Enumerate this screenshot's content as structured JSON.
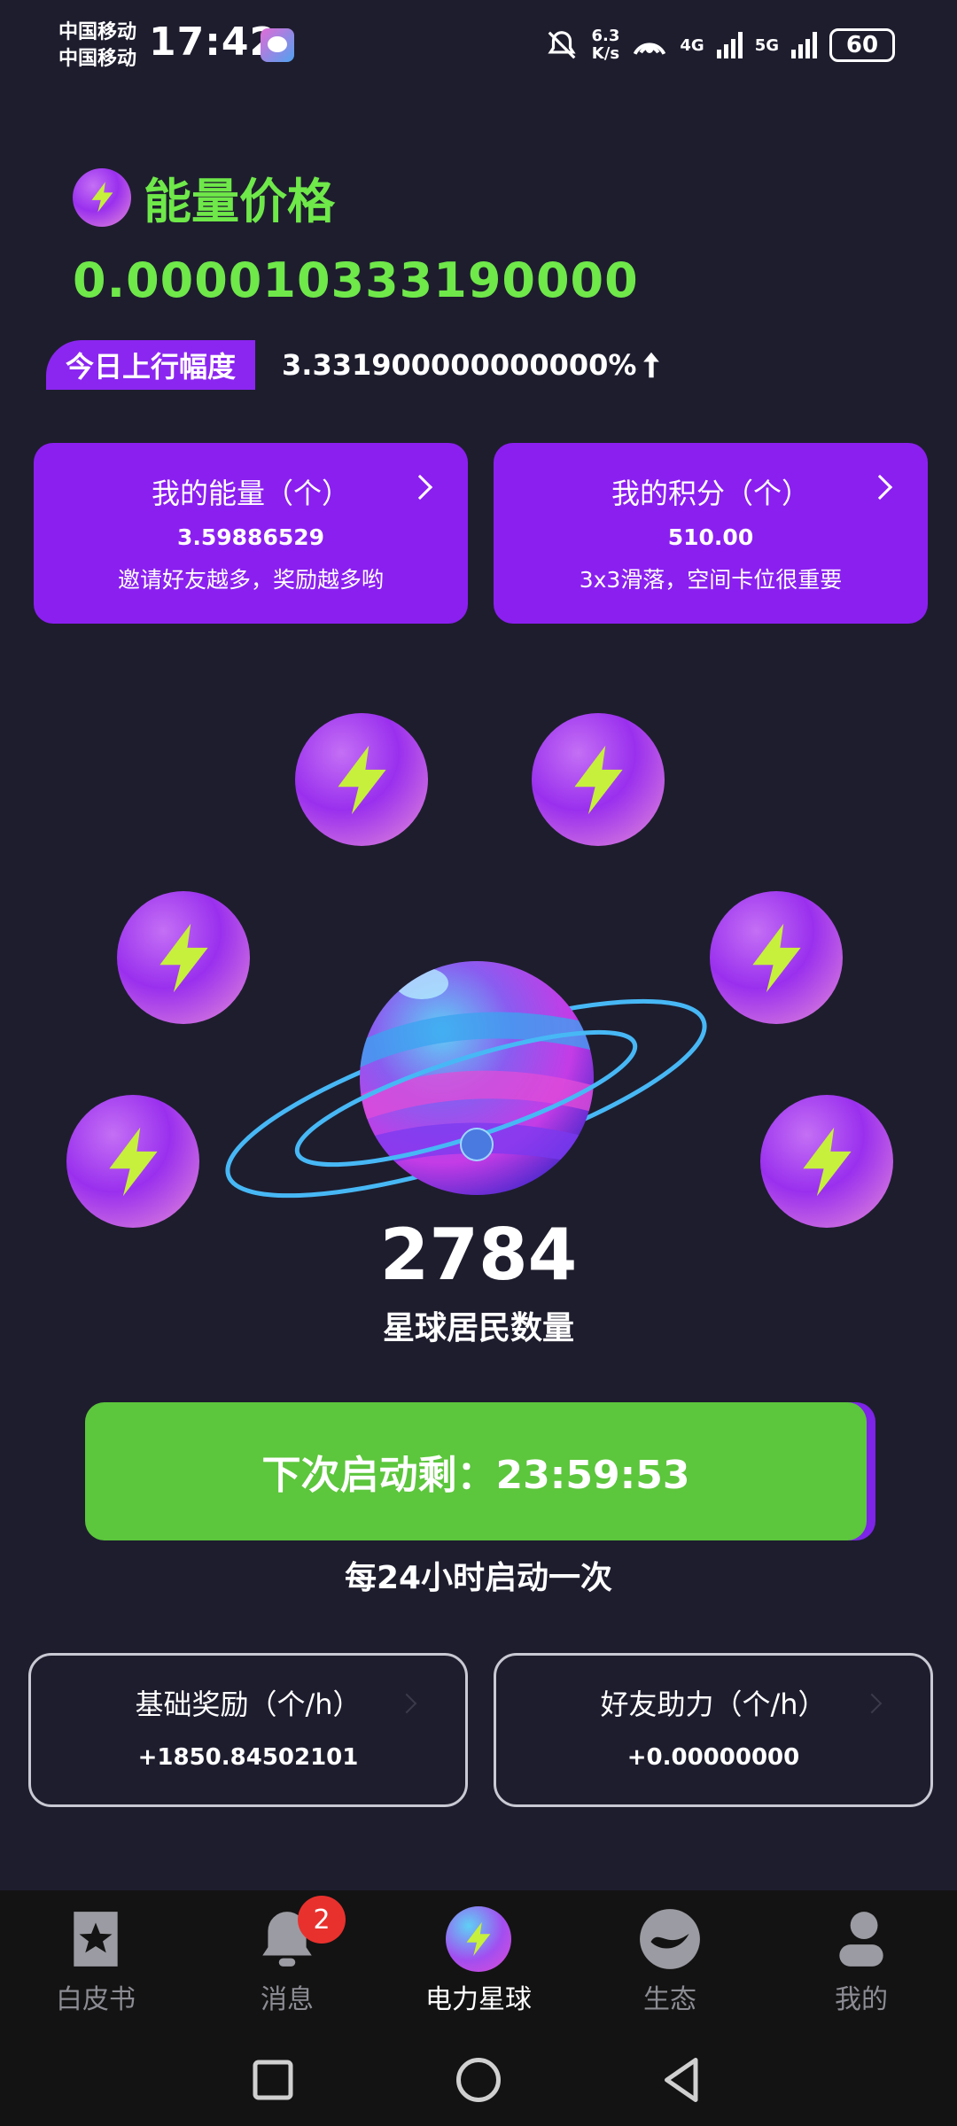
{
  "status_bar": {
    "carrier_1": "中国移动",
    "carrier_2": "中国移动",
    "time": "17:42",
    "speed_top": "6.3",
    "speed_unit": "K/s",
    "net_1": "4G",
    "net_2": "5G",
    "battery": "60"
  },
  "price": {
    "title": "能量价格",
    "value": "0.000010333190000",
    "rise_label": "今日上行幅度",
    "rise_value": "3.331900000000000%",
    "rise_icon": "arrow-up-icon"
  },
  "cards": [
    {
      "title": "我的能量（个）",
      "value": "3.59886529",
      "desc": "邀请好友越多，奖励越多哟"
    },
    {
      "title": "我的积分（个）",
      "value": "510.00",
      "desc": "3x3滑落，空间卡位很重要"
    }
  ],
  "planet": {
    "resident_count": "2784",
    "resident_label": "星球居民数量"
  },
  "launch": {
    "button_label": "下次启动剩：23:59:53",
    "note": "每24小时启动一次"
  },
  "rewards": [
    {
      "title": "基础奖励（个/h）",
      "value": "+1850.84502101"
    },
    {
      "title": "好友助力（个/h）",
      "value": "+0.00000000"
    }
  ],
  "bottom_nav": {
    "items": [
      {
        "label": "白皮书",
        "icon": "star-book-icon"
      },
      {
        "label": "消息",
        "icon": "bell-icon",
        "badge": "2"
      },
      {
        "label": "电力星球",
        "icon": "planet-bolt-icon",
        "active": true
      },
      {
        "label": "生态",
        "icon": "ecology-icon"
      },
      {
        "label": "我的",
        "icon": "person-icon"
      }
    ]
  },
  "colors": {
    "background": "#1e1d2e",
    "accent_green": "#6fe84a",
    "purple": "#8b1ff0",
    "button_green": "#5cc63c",
    "badge_red": "#e8312d"
  }
}
